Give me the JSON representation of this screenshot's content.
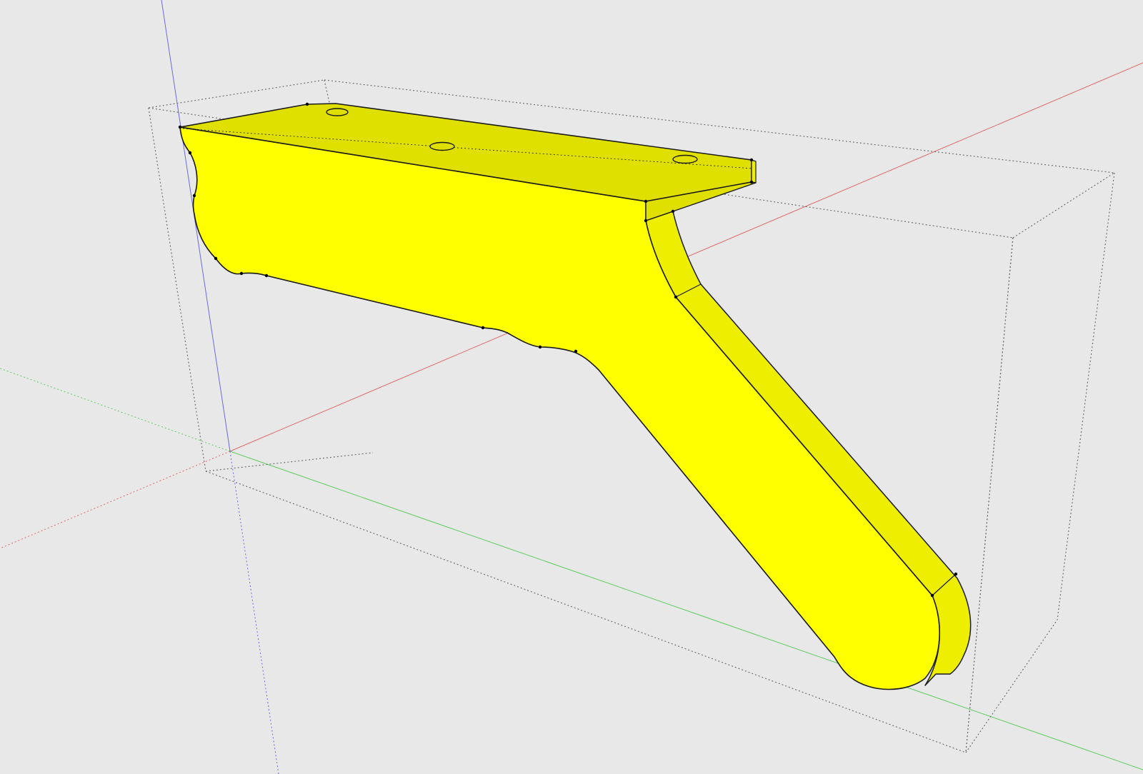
{
  "viewport": {
    "background_color": "#e8e8e8"
  },
  "colors": {
    "axis_red": "#e06a6a",
    "axis_green": "#5ccc5c",
    "axis_blue": "#6a6ae0",
    "bounding_box": "#707070",
    "model_face_front": "#ffff00",
    "model_face_top": "#e0e000",
    "model_face_side": "#eeee00",
    "model_edge": "#1a1a1a",
    "vertex": "#000000"
  },
  "model": {
    "type": "3D bracket leg component",
    "selected": true,
    "mounting_holes": 3
  }
}
